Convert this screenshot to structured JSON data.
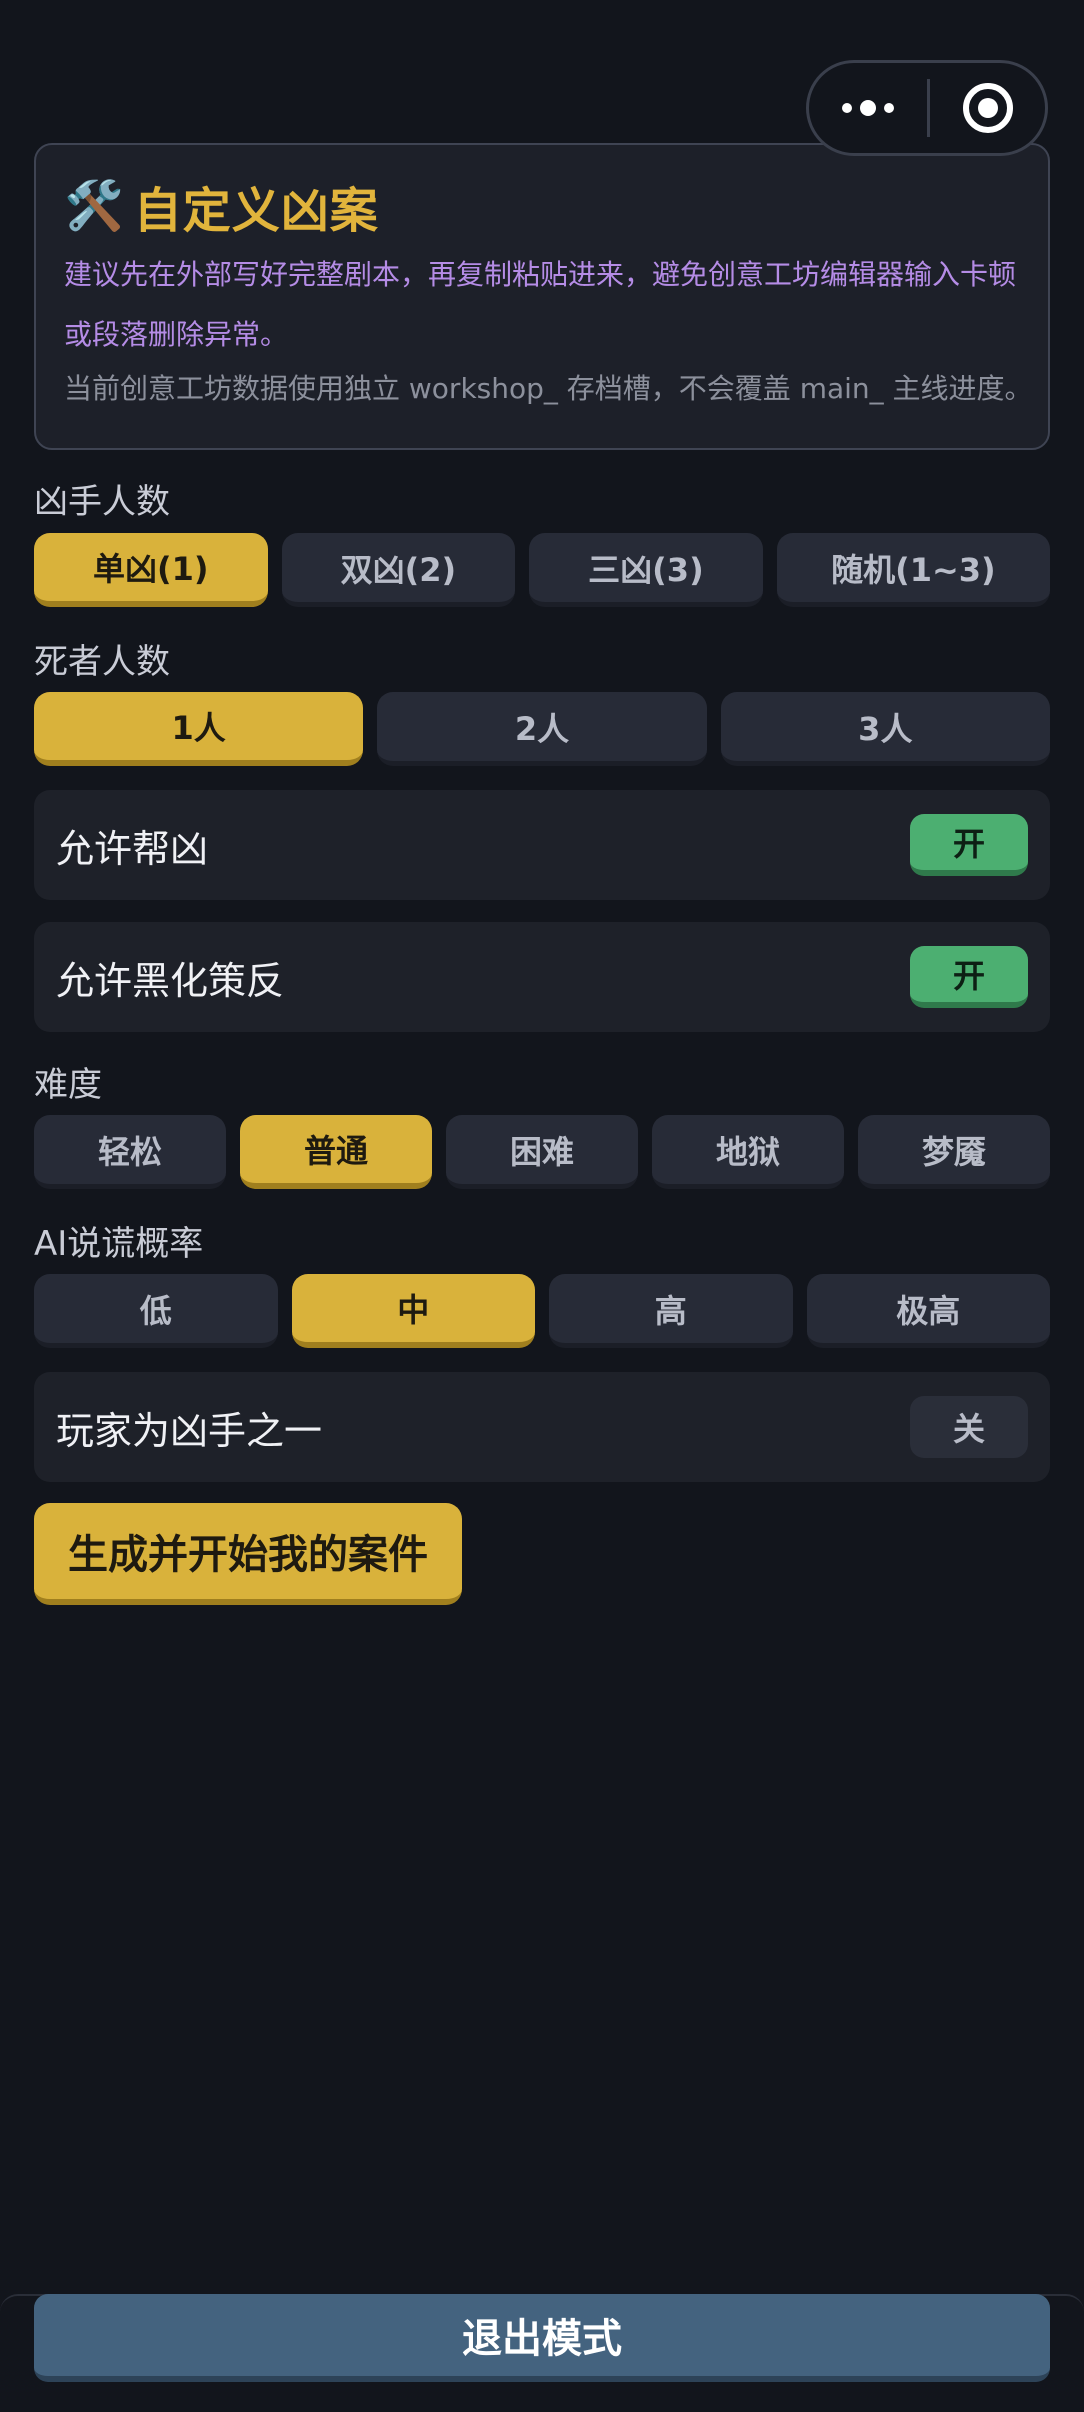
{
  "capsule": {
    "more_icon": "more-dots-icon",
    "close_icon": "target-icon"
  },
  "info": {
    "icon": "🛠️",
    "title": "自定义凶案",
    "tip": "建议先在外部写好完整剧本，再复制粘贴进来，避免创意工坊编辑器输入卡顿或段落删除异常。",
    "note": "当前创意工坊数据使用独立 workshop_ 存档槽，不会覆盖 main_ 主线进度。"
  },
  "killers": {
    "label": "凶手人数",
    "options": [
      "单凶(1)",
      "双凶(2)",
      "三凶(3)",
      "随机(1~3)"
    ],
    "selected": "单凶(1)"
  },
  "victims": {
    "label": "死者人数",
    "options": [
      "1人",
      "2人",
      "3人"
    ],
    "selected": "1人"
  },
  "toggles": {
    "accomplice": {
      "label": "允许帮凶",
      "state": "开"
    },
    "corruption": {
      "label": "允许黑化策反",
      "state": "开"
    },
    "player_killer": {
      "label": "玩家为凶手之一",
      "state": "关"
    }
  },
  "difficulty": {
    "label": "难度",
    "options": [
      "轻松",
      "普通",
      "困难",
      "地狱",
      "梦魇"
    ],
    "selected": "普通"
  },
  "lie_rate": {
    "label": "AI说谎概率",
    "options": [
      "低",
      "中",
      "高",
      "极高"
    ],
    "selected": "中"
  },
  "generate_button": "生成并开始我的案件",
  "exit_button": "退出模式",
  "colors": {
    "accent": "#d9b23b",
    "toggle_on": "#4caf71",
    "exit": "#44637f",
    "tip": "#b58ce6"
  }
}
